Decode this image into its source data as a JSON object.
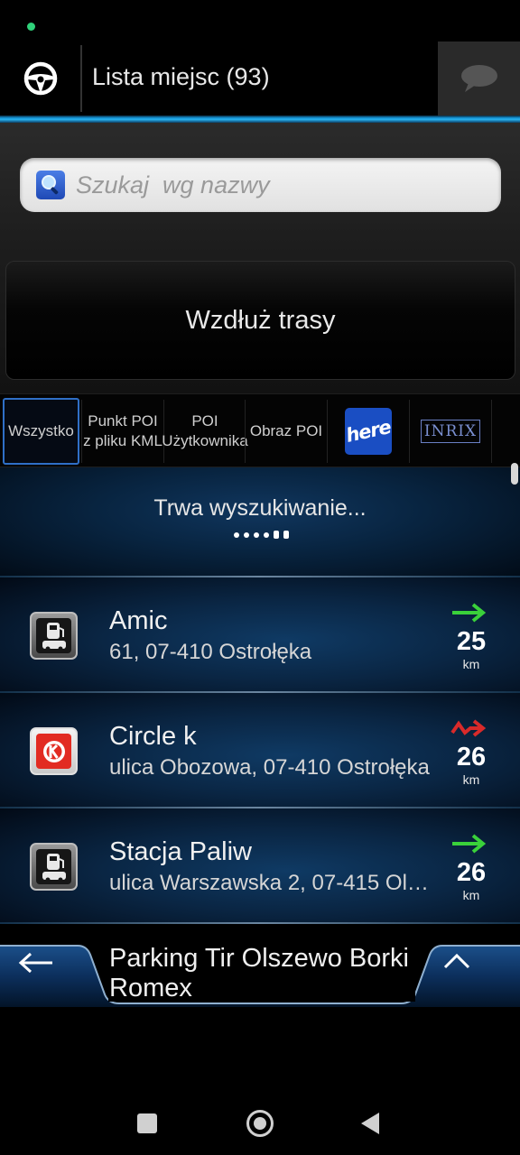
{
  "header": {
    "title": "Lista miejsc (93)",
    "steering_icon": "steering-wheel-icon",
    "chat_icon": "chat-bubble-icon"
  },
  "search": {
    "placeholder": "Szukaj  wg nazwy",
    "value": ""
  },
  "route_button": {
    "label": "Wzdłuż trasy"
  },
  "filters": [
    {
      "label": "Wszystko",
      "active": true
    },
    {
      "label": "Punkt POI z pliku KML",
      "line1": "Punkt POI",
      "line2": "z pliku KML"
    },
    {
      "label": "POI Użytkownika",
      "line1": "POI",
      "line2": "Użytkownika"
    },
    {
      "label": "Obraz POI"
    },
    {
      "label": "here",
      "logo": true
    },
    {
      "label": "INRIX",
      "logo": true
    }
  ],
  "searching": {
    "text": "Trwa wyszukiwanie..."
  },
  "results": [
    {
      "name": "Amic",
      "address": "61, 07-410 Ostrołęka",
      "distance": "25",
      "unit": "km",
      "direction": "straight",
      "direction_color": "#3ad13a",
      "icon": "fuel-station-icon"
    },
    {
      "name": "Circle k",
      "address": "ulica Obozowa, 07-410 Ostrołęka",
      "distance": "26",
      "unit": "km",
      "direction": "detour",
      "direction_color": "#d92a2a",
      "icon": "circle-k-logo-icon"
    },
    {
      "name": "Stacja Paliw",
      "address": "ulica Warszawska 2, 07-415 Olsze…",
      "distance": "26",
      "unit": "km",
      "direction": "straight",
      "direction_color": "#3ad13a",
      "icon": "fuel-station-icon"
    }
  ],
  "bottom_bar": {
    "next_title_line1": "Parking Tir Olszewo Borki",
    "next_title_line2": "Romex",
    "back_icon": "arrow-left-icon",
    "up_icon": "chevron-up-icon"
  },
  "colors": {
    "accent_blue": "#1596d8",
    "filter_active_border": "#2f6fc7",
    "arrow_green": "#3ad13a",
    "arrow_red": "#d92a2a"
  }
}
